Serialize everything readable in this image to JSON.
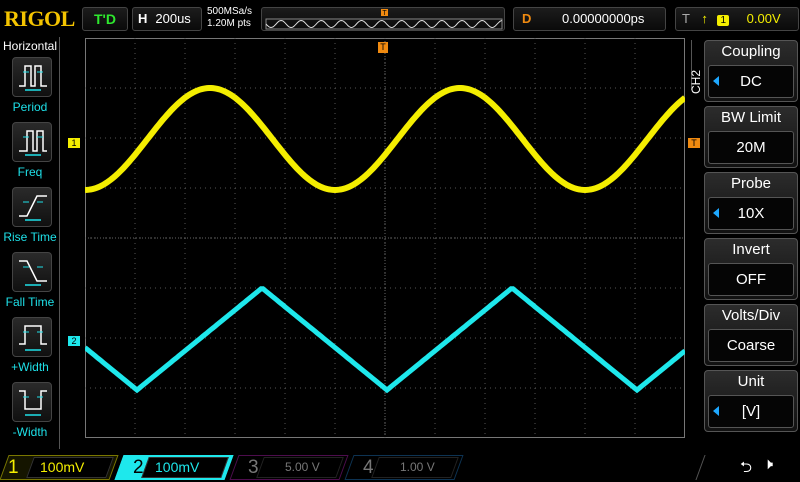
{
  "header": {
    "logo": "RIGOL",
    "run_state": "T'D",
    "h_label": "H",
    "timebase": "200us",
    "sample_rate": "500MSa/s",
    "memory_depth": "1.20M pts",
    "delay_label": "D",
    "delay_value": "0.00000000ps",
    "trigger_label": "T",
    "trigger_source": "1",
    "trigger_level": "0.00V"
  },
  "left_menu": {
    "title": "Horizontal",
    "items": [
      {
        "label": "Period",
        "icon": "period-icon"
      },
      {
        "label": "Freq",
        "icon": "freq-icon"
      },
      {
        "label": "Rise Time",
        "icon": "rise-time-icon"
      },
      {
        "label": "Fall Time",
        "icon": "fall-time-icon"
      },
      {
        "label": "+Width",
        "icon": "pos-width-icon"
      },
      {
        "label": "-Width",
        "icon": "neg-width-icon"
      }
    ]
  },
  "right_menu": {
    "channel": "CH2",
    "items": [
      {
        "title": "Coupling",
        "value": "DC"
      },
      {
        "title": "BW Limit",
        "value": "20M"
      },
      {
        "title": "Probe",
        "value": "10X"
      },
      {
        "title": "Invert",
        "value": "OFF"
      },
      {
        "title": "Volts/Div",
        "value": "Coarse"
      },
      {
        "title": "Unit",
        "value": "[V]"
      }
    ]
  },
  "markers": {
    "ch1": "1",
    "ch2": "2",
    "trigger": "T"
  },
  "channels": [
    {
      "num": "1",
      "scale": "100mV",
      "color": "#f4ee00"
    },
    {
      "num": "2",
      "scale": "100mV",
      "color": "#1ee8ec"
    },
    {
      "num": "3",
      "scale": "5.00 V",
      "color": "#c020c0"
    },
    {
      "num": "4",
      "scale": "1.00 V",
      "color": "#2080d0"
    }
  ],
  "colors": {
    "ch1": "#f4ee00",
    "ch2": "#1ee8ec",
    "trigger": "#f08a10",
    "menu_text": "#1ee0e8"
  }
}
